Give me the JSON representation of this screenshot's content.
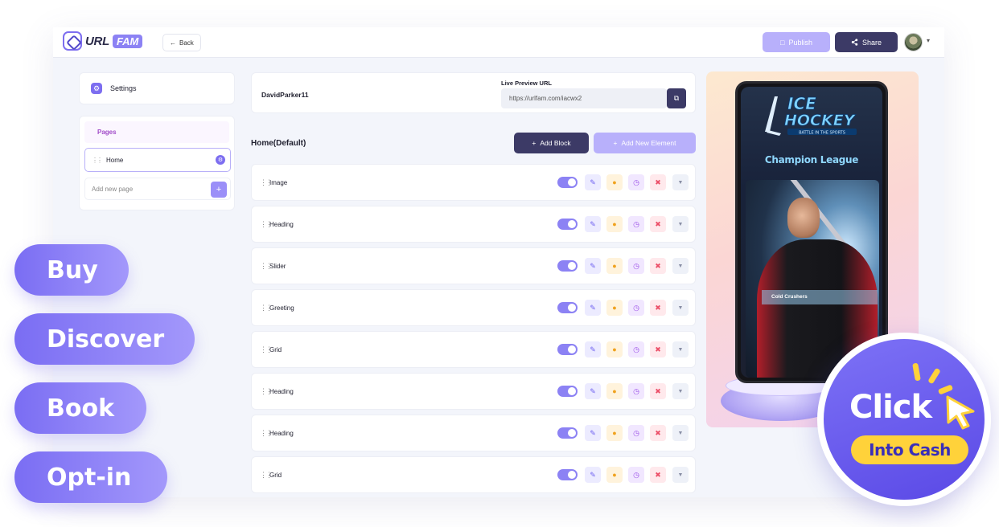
{
  "topbar": {
    "logo_url": "URL",
    "logo_fam": "FAM",
    "back_label": "Back",
    "publish_label": "Publish",
    "share_label": "Share"
  },
  "sidebar": {
    "settings_label": "Settings",
    "pages_heading": "Pages",
    "home_page": "Home",
    "add_page_placeholder": "Add new page"
  },
  "main": {
    "user_name": "DavidParker11",
    "preview_label": "Live Preview URL",
    "preview_url": "https://urlfam.com/iacwx2",
    "page_title": "Home(Default)",
    "add_block_label": "Add Block",
    "add_element_label": "Add New Element",
    "blocks": [
      {
        "label": "Image",
        "enabled": true
      },
      {
        "label": "Heading",
        "enabled": true
      },
      {
        "label": "Slider",
        "enabled": true
      },
      {
        "label": "Greeting",
        "enabled": true
      },
      {
        "label": "Grid",
        "enabled": true
      },
      {
        "label": "Heading",
        "enabled": true
      },
      {
        "label": "Heading",
        "enabled": true
      },
      {
        "label": "Grid",
        "enabled": true
      }
    ]
  },
  "preview": {
    "logo_line1": "ICE",
    "logo_line2": "HOCKEY",
    "logo_tagline": "BATTLE IN THE SPORTS",
    "league_title": "Champion League",
    "banner_text": "Cold Crushers"
  },
  "promo": {
    "pills": [
      "Buy",
      "Discover",
      "Book",
      "Opt-in"
    ],
    "click_text": "Click",
    "cash_text": "Into Cash"
  },
  "colors": {
    "accent": "#7d6ef0",
    "dark": "#3c3a66",
    "light_accent": "#b8b0fb",
    "yellow": "#ffd23a"
  },
  "icons": [
    "back-arrow-icon",
    "publish-file-icon",
    "share-icon",
    "gear-icon",
    "drag-handle-icon",
    "edit-icon",
    "chat-icon",
    "clock-icon",
    "trash-icon",
    "chevron-down-icon",
    "plus-icon",
    "copy-icon",
    "cursor-icon"
  ]
}
